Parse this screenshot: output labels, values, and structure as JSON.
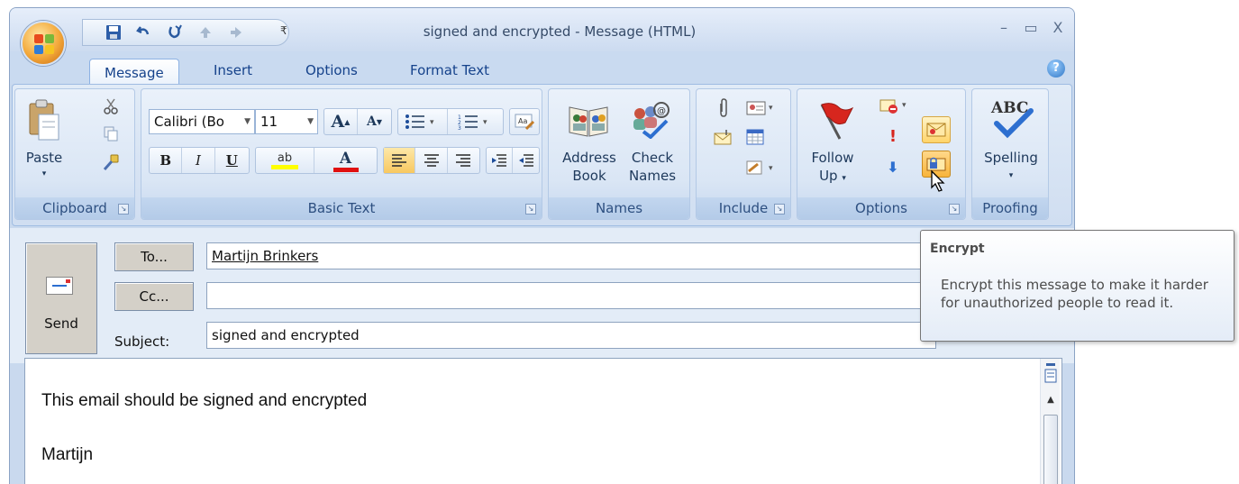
{
  "window": {
    "title": "signed and encrypted - Message (HTML)",
    "controls": [
      "minimize-icon",
      "maximize-icon",
      "close-icon"
    ],
    "control_glyphs": [
      "–",
      "▭",
      "X"
    ]
  },
  "quick_access": {
    "items": [
      "save-icon",
      "undo-icon",
      "redo-icon",
      "previous-item-icon",
      "next-item-icon"
    ],
    "more_glyph": "₹"
  },
  "tabs": [
    {
      "label": "Message",
      "active": true
    },
    {
      "label": "Insert",
      "active": false
    },
    {
      "label": "Options",
      "active": false
    },
    {
      "label": "Format Text",
      "active": false
    }
  ],
  "help_glyph": "?",
  "ribbon": {
    "clipboard": {
      "label": "Clipboard",
      "paste": "Paste"
    },
    "basic_text": {
      "label": "Basic Text",
      "font": "Calibri (Bo",
      "size": "11",
      "grow": "A",
      "shrink": "A",
      "bold": "B",
      "italic": "I",
      "underline": "U",
      "highlight": "ab",
      "font_color": "A"
    },
    "names": {
      "label": "Names",
      "address_book_1": "Address",
      "address_book_2": "Book",
      "check_names_1": "Check",
      "check_names_2": "Names"
    },
    "include": {
      "label": "Include"
    },
    "options": {
      "label": "Options",
      "follow_up_1": "Follow",
      "follow_up_2": "Up",
      "high_importance": "!",
      "low_importance": "⬇"
    },
    "proofing": {
      "label": "Proofing",
      "spelling": "Spelling",
      "abc": "ABC"
    }
  },
  "compose": {
    "send": "Send",
    "to_button": "To...",
    "cc_button": "Cc...",
    "subject_label": "Subject:",
    "to_value": "Martijn Brinkers",
    "cc_value": "",
    "subject_value": "signed and encrypted"
  },
  "body": {
    "line1": "This email should be signed and encrypted",
    "line2": "Martijn"
  },
  "tooltip": {
    "title": "Encrypt",
    "text": "Encrypt this message to make it harder for unauthorized people to read it."
  },
  "colors": {
    "ribbon_text": "#15428b",
    "highlight_yellow": "#ffff00",
    "font_red": "#e01010",
    "flag_red": "#d7261e"
  }
}
